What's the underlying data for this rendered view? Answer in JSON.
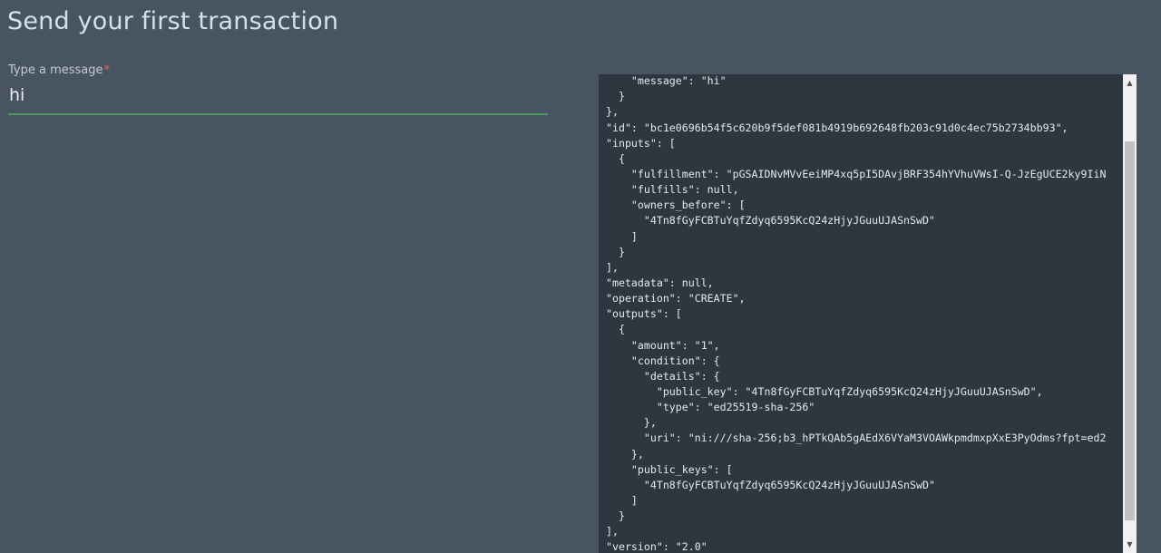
{
  "page": {
    "title": "Send your first transaction"
  },
  "message_field": {
    "label": "Type a message",
    "required_marker": "*",
    "value": "hi"
  },
  "code_viewer": {
    "lines": [
      "    \"message\": \"hi\"",
      "    \"message\": \"hi\"",
      "  }",
      "},",
      "\"id\": \"bc1e0696b54f5c620b9f5def081b4919b692648fb203c91d0c4ec75b2734bb93\",",
      "\"inputs\": [",
      "  {",
      "    \"fulfillment\": \"pGSAIDNvMVvEeiMP4xq5pI5DAvjBRF354hYVhuVWsI-Q-JzEgUCE2ky9IiN",
      "    \"fulfills\": null,",
      "    \"owners_before\": [",
      "      \"4Tn8fGyFCBTuYqfZdyq6595KcQ24zHjyJGuuUJASnSwD\"",
      "    ]",
      "  }",
      "],",
      "\"metadata\": null,",
      "\"operation\": \"CREATE\",",
      "\"outputs\": [",
      "  {",
      "    \"amount\": \"1\",",
      "    \"condition\": {",
      "      \"details\": {",
      "        \"public_key\": \"4Tn8fGyFCBTuYqfZdyq6595KcQ24zHjyJGuuUJASnSwD\",",
      "        \"type\": \"ed25519-sha-256\"",
      "      },",
      "      \"uri\": \"ni:///sha-256;b3_hPTkQAb5gAEdX6VYaM3VOAWkpmdmxpXxE3PyOdms?fpt=ed2",
      "    },",
      "    \"public_keys\": [",
      "      \"4Tn8fGyFCBTuYqfZdyq6595KcQ24zHjyJGuuUJASnSwD\"",
      "    ]",
      "  }",
      "],",
      "\"version\": \"2.0\""
    ]
  },
  "scrollbar": {
    "up_icon": "arrow-up-icon",
    "down_icon": "arrow-down-icon",
    "up_glyph": "▲",
    "down_glyph": "▼"
  },
  "colors": {
    "background": "#485462",
    "code_background": "#2e3640",
    "input_underline": "#4a9a5c",
    "title_text": "#cfe3ee"
  }
}
